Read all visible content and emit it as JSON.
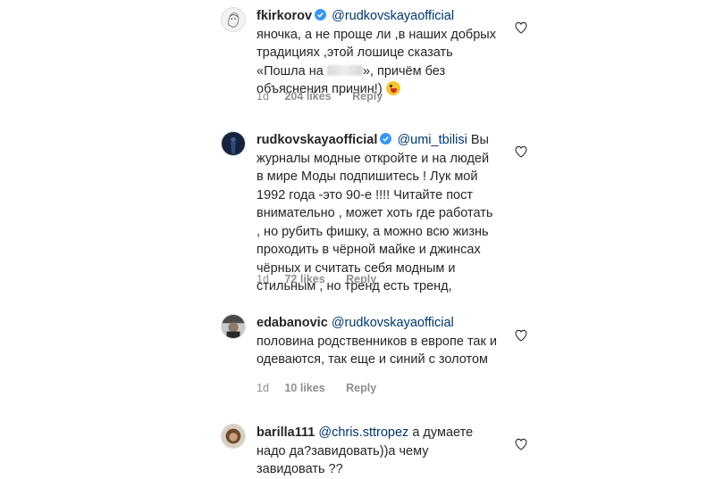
{
  "comments": [
    {
      "username": "fkirkorov",
      "verified": true,
      "mention": "@rudkovskayaofficial",
      "text_before_blur": "яночка, а не проще ли ,в наших добрых традициях ,этой лошице сказать «Пошла на ",
      "text_after_blur": "», причём без объяснения причин!)",
      "emoji": "winking-face-with-tongue",
      "time": "1d",
      "likes": "204 likes",
      "reply": "Reply",
      "avatar": "sketch-portrait"
    },
    {
      "username": "rudkovskayaofficial",
      "verified": true,
      "mention": "@umi_tbilisi",
      "text": "Вы журналы модные откройте и на людей в мире Моды подпишитесь ! Лук мой 1992 года -это 90-е !!!! Читайте пост внимательно , может хоть где работать , но рубить фишку, а можно всю жизнь проходить в чёрной майке и джинсах чёрных и считать себя модным и стильным , но тренд есть тренд,",
      "time": "1d",
      "likes": "72 likes",
      "reply": "Reply",
      "avatar": "dark-blue-silhouette"
    },
    {
      "username": "edabanovic",
      "verified": false,
      "mention": "@rudkovskayaofficial",
      "text": "половина родственников в европе так и одеваются, так еще и синий с золотом",
      "time": "1d",
      "likes": "10 likes",
      "reply": "Reply",
      "avatar": "man-with-cap"
    },
    {
      "username": "barilla111",
      "verified": false,
      "mention": "@chris.sttropez",
      "text": "а думаете надо да?завидовать))а чему завидовать ??",
      "avatar": "woman-curly-hair"
    }
  ],
  "colors": {
    "text": "#262626",
    "meta": "#8e8e8e",
    "mention": "#00376b",
    "verified": "#3897f0"
  },
  "icons": {
    "like": "heart-outline-icon",
    "verified": "verified-badge-icon"
  }
}
